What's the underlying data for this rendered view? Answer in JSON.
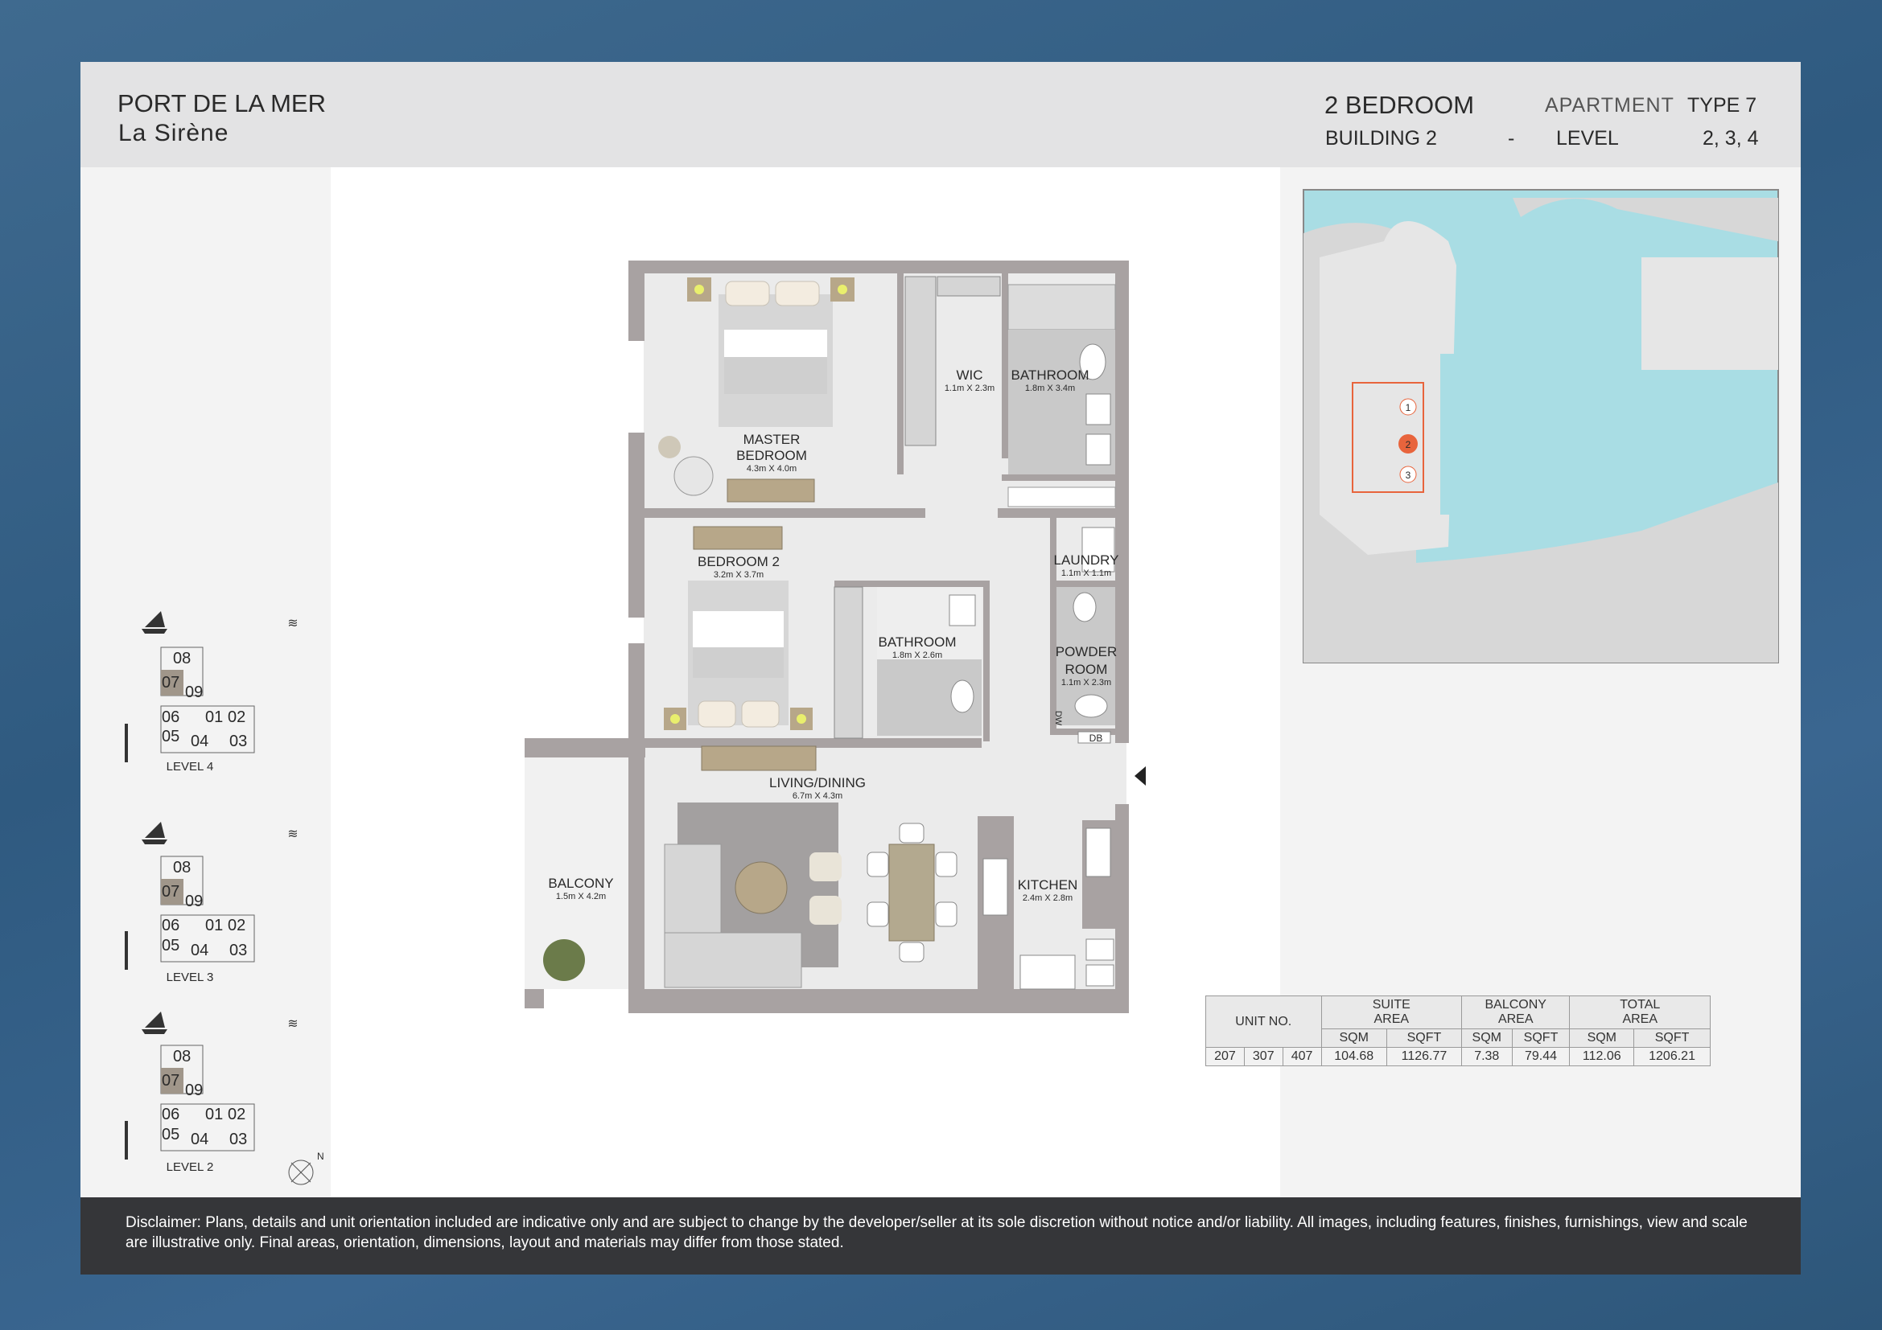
{
  "header": {
    "project": "PORT DE LA MER",
    "building_name": "La Sirène",
    "unit_type": "2 BEDROOM",
    "apartment_label": "APARTMENT",
    "type_label": "TYPE 7",
    "building_label": "BUILDING 2",
    "dash": "-",
    "level_label": "LEVEL",
    "levels": "2, 3, 4"
  },
  "rooms": {
    "wic": {
      "name": "WIC",
      "dims": "1.1m X 2.3m"
    },
    "bathroom1": {
      "name": "BATHROOM",
      "dims": "1.8m X 3.4m"
    },
    "master": {
      "name1": "MASTER",
      "name2": "BEDROOM",
      "dims": "4.3m X 4.0m"
    },
    "bedroom2": {
      "name": "BEDROOM 2",
      "dims": "3.2m X 3.7m"
    },
    "bathroom2": {
      "name": "BATHROOM",
      "dims": "1.8m X 2.6m"
    },
    "laundry": {
      "name": "LAUNDRY",
      "dims": "1.1m X 1.1m"
    },
    "powder": {
      "name1": "POWDER",
      "name2": "ROOM",
      "dims": "1.1m X 2.3m"
    },
    "living": {
      "name": "LIVING/DINING",
      "dims": "6.7m X 4.3m"
    },
    "balcony": {
      "name": "BALCONY",
      "dims": "1.5m X 4.2m"
    },
    "kitchen": {
      "name": "KITCHEN",
      "dims": "2.4m X 2.8m"
    },
    "db": "DB",
    "dw": "DW"
  },
  "keyplans": [
    {
      "level": "LEVEL 4",
      "units": [
        "08",
        "07",
        "09",
        "06",
        "01",
        "02",
        "05",
        "04",
        "03"
      ]
    },
    {
      "level": "LEVEL 3",
      "units": [
        "08",
        "07",
        "09",
        "06",
        "01",
        "02",
        "05",
        "04",
        "03"
      ]
    },
    {
      "level": "LEVEL 2",
      "units": [
        "08",
        "07",
        "09",
        "06",
        "01",
        "02",
        "05",
        "04",
        "03"
      ]
    }
  ],
  "north_label": "N",
  "location_map": {
    "buildings": [
      "1",
      "2",
      "3"
    ],
    "highlight": "2",
    "water_color": "#a9dde4",
    "highlight_color": "#e8643c"
  },
  "area_table": {
    "unit_no": "UNIT NO.",
    "suite_area": [
      "SUITE",
      "AREA"
    ],
    "balcony_area": [
      "BALCONY",
      "AREA"
    ],
    "total_area": [
      "TOTAL",
      "AREA"
    ],
    "sqm": "SQM",
    "sqft": "SQFT",
    "units": [
      "207",
      "307",
      "407"
    ],
    "suite_sqm": "104.68",
    "suite_sqft": "1126.77",
    "balcony_sqm": "7.38",
    "balcony_sqft": "79.44",
    "total_sqm": "112.06",
    "total_sqft": "1206.21"
  },
  "disclaimer": "Disclaimer: Plans, details and unit orientation included are indicative only and are subject to change by the developer/seller at its sole discretion without notice and/or liability. All images, including features, finishes, furnishings, view and scale are illustrative only. Final areas, orientation, dimensions, layout and materials may differ from those stated."
}
